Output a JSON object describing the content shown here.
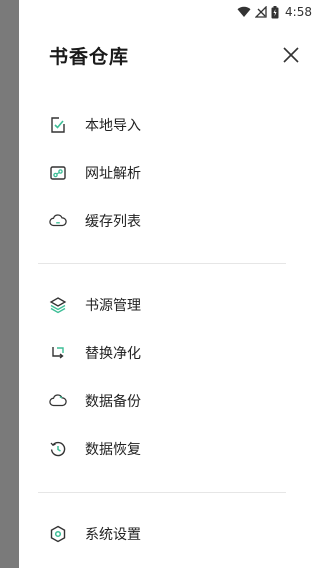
{
  "status_bar": {
    "time": "4:58",
    "icons": [
      "wifi-icon",
      "no-signal-icon",
      "battery-icon"
    ]
  },
  "drawer": {
    "title": "书香仓库",
    "close_icon": "close-icon",
    "groups": [
      [
        {
          "label": "本地导入",
          "icon": "local-import-icon"
        },
        {
          "label": "网址解析",
          "icon": "url-parse-icon"
        },
        {
          "label": "缓存列表",
          "icon": "cache-cloud-icon"
        }
      ],
      [
        {
          "label": "书源管理",
          "icon": "layers-icon"
        },
        {
          "label": "替换净化",
          "icon": "replace-icon"
        },
        {
          "label": "数据备份",
          "icon": "backup-cloud-icon"
        },
        {
          "label": "数据恢复",
          "icon": "restore-clock-icon"
        }
      ],
      [
        {
          "label": "系统设置",
          "icon": "settings-hexagon-icon"
        }
      ]
    ]
  },
  "colors": {
    "accent": "#3dbe96",
    "icon_stroke": "#333333",
    "scrim": "#7a7a7a"
  }
}
